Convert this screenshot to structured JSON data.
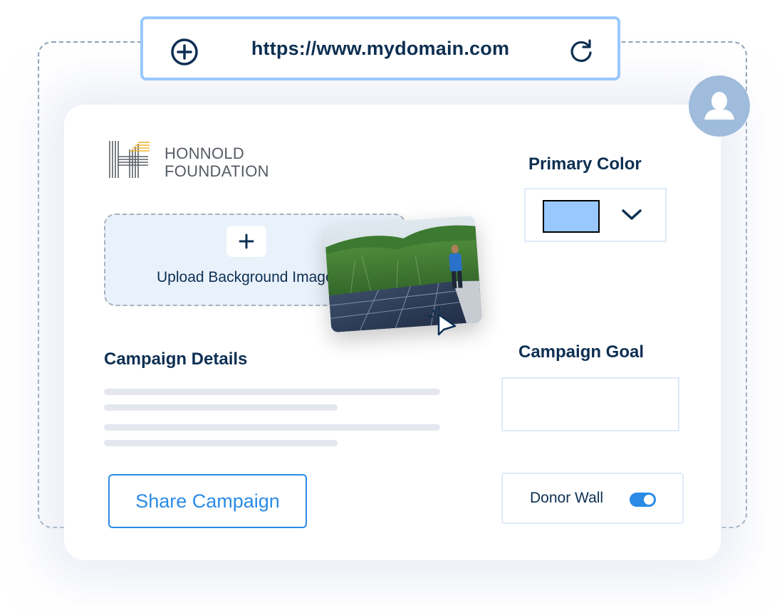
{
  "browser": {
    "url": "https://www.mydomain.com",
    "new_tab_icon": "plus-circle-icon",
    "reload_icon": "reload-icon"
  },
  "user": {
    "avatar_icon": "user-avatar-icon"
  },
  "logo": {
    "line1": "HONNOLD",
    "line2": "FOUNDATION",
    "accent_color": "#f2b52b"
  },
  "upload": {
    "label": "Upload Background Image",
    "plus_icon": "plus-icon",
    "preview_alt": "Person standing on rooftop solar panels in a forest",
    "cursor_icon": "pointer-cursor-icon"
  },
  "primary_color": {
    "label": "Primary Color",
    "selected_color": "#99c8ff",
    "dropdown_icon": "chevron-down-icon"
  },
  "campaign_details": {
    "label": "Campaign Details",
    "placeholder_lines": 4
  },
  "campaign_goal": {
    "label": "Campaign Goal",
    "value": ""
  },
  "donor_wall": {
    "label": "Donor Wall",
    "enabled": true
  },
  "share_button": {
    "label": "Share Campaign"
  },
  "colors": {
    "navy": "#0d2f52",
    "accent_blue": "#2a8be6",
    "url_border": "#99c8ff",
    "upload_bg": "#e9f1fb"
  }
}
